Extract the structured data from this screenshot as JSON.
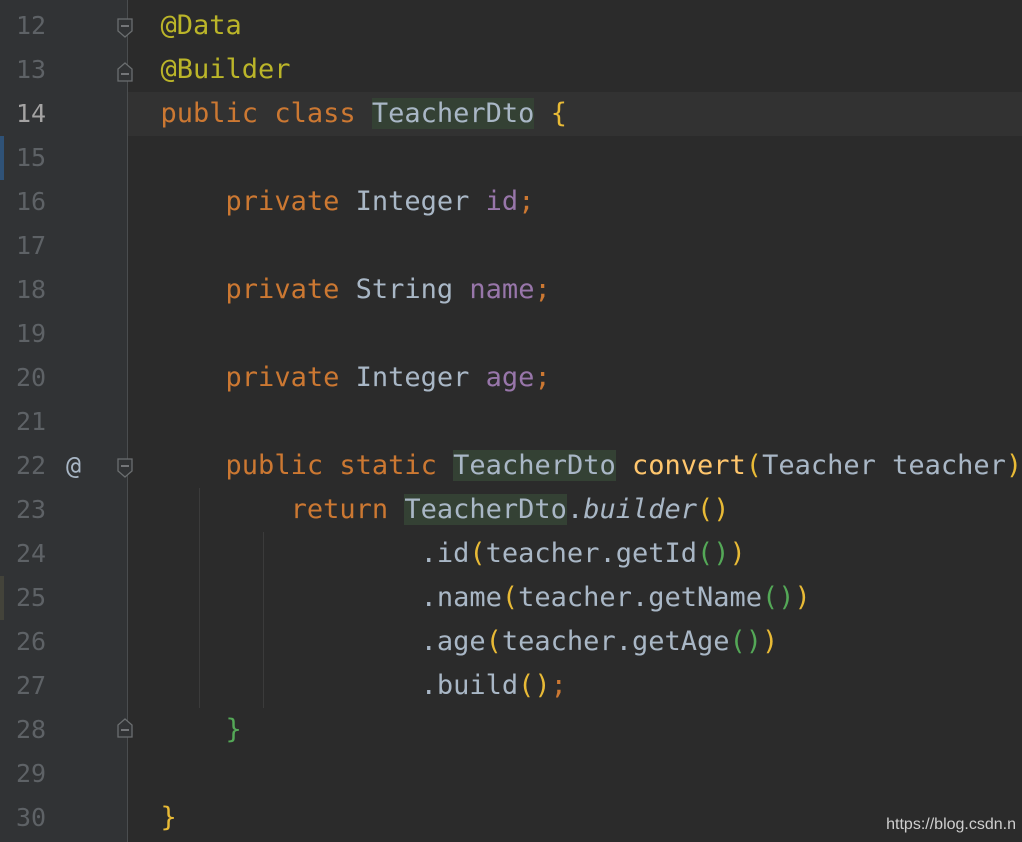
{
  "line_numbers": [
    "12",
    "13",
    "14",
    "15",
    "16",
    "17",
    "18",
    "19",
    "20",
    "21",
    "22",
    "23",
    "24",
    "25",
    "26",
    "27",
    "28",
    "29",
    "30"
  ],
  "current_line": "14",
  "gutter_icons": {
    "implements_marker": "@"
  },
  "code": {
    "l12": {
      "annotation": "@Data"
    },
    "l13": {
      "annotation": "@Builder"
    },
    "l14": {
      "kw1": "public",
      "kw2": "class",
      "name": "TeacherDto",
      "brace": "{"
    },
    "l16": {
      "kw": "private",
      "type": "Integer",
      "field": "id",
      "semi": ";"
    },
    "l18": {
      "kw": "private",
      "type": "String",
      "field": "name",
      "semi": ";"
    },
    "l20": {
      "kw": "private",
      "type": "Integer",
      "field": "age",
      "semi": ";"
    },
    "l22": {
      "kw1": "public",
      "kw2": "static",
      "ret": "TeacherDto",
      "method": "convert",
      "open": "(",
      "param": "Teacher teacher",
      "close": ")",
      "brace": "{"
    },
    "l23": {
      "kw": "return",
      "cls": "TeacherDto",
      "dot": ".",
      "call": "builder",
      "parens": "()"
    },
    "l24": {
      "call": ".id",
      "open": "(",
      "arg": "teacher.getId",
      "inner": "()",
      "close": ")"
    },
    "l25": {
      "call": ".name",
      "open": "(",
      "arg": "teacher.getName",
      "inner": "()",
      "close": ")"
    },
    "l26": {
      "call": ".age",
      "open": "(",
      "arg": "teacher.getAge",
      "inner": "()",
      "close": ")"
    },
    "l27": {
      "call": ".build",
      "parens": "()",
      "semi": ";"
    },
    "l28": {
      "brace": "}"
    },
    "l30": {
      "brace": "}"
    }
  },
  "watermark": "https://blog.csdn.n",
  "colors": {
    "background": "#2b2b2b",
    "gutter": "#313335",
    "keyword": "#cc7832",
    "annotation": "#bbb529",
    "field": "#9876aa",
    "method": "#ffc66d",
    "highlight": "#344134"
  }
}
